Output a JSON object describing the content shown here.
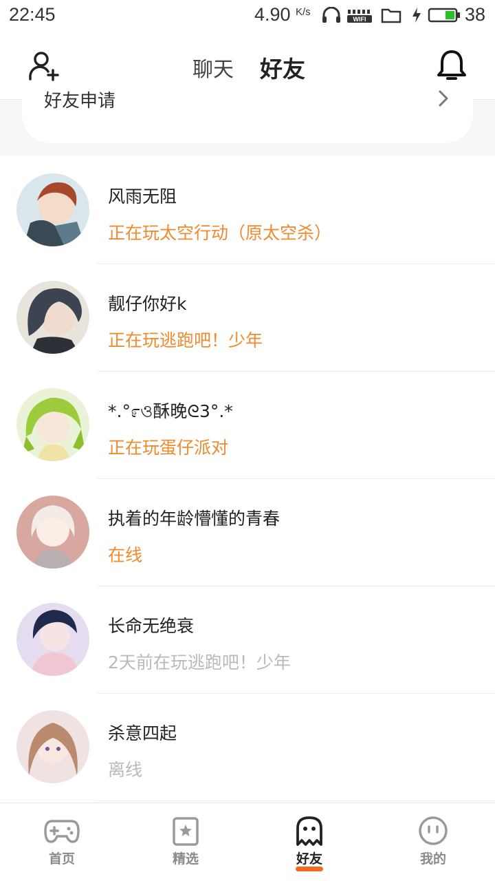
{
  "status_bar": {
    "time": "22:45",
    "net_speed": "4.90",
    "net_speed_unit": "K/s",
    "wifi_label": "WIFI",
    "battery_percent": "38"
  },
  "header": {
    "tabs": [
      {
        "label": "聊天",
        "active": false
      },
      {
        "label": "好友",
        "active": true
      }
    ],
    "accent_color": "#f26b1d"
  },
  "friend_request": {
    "label": "好友申请"
  },
  "friends": [
    {
      "name": "风雨无阻",
      "status": "正在玩太空行动（原太空杀）",
      "online": true
    },
    {
      "name": "靓仔你好k",
      "status": "正在玩逃跑吧！少年",
      "online": true
    },
    {
      "name": "*.°೯ও酥晚ᘓ3°.*",
      "status": "正在玩蛋仔派对",
      "online": true
    },
    {
      "name": "执着的年龄懵懂的青春",
      "status": "在线",
      "online": true
    },
    {
      "name": "长命无绝衰",
      "status": "2天前在玩逃跑吧！少年",
      "online": false
    },
    {
      "name": "杀意四起",
      "status": "离线",
      "online": false
    }
  ],
  "bottom_nav": {
    "items": [
      {
        "label": "首页",
        "icon": "gamepad-icon",
        "active": false
      },
      {
        "label": "精选",
        "icon": "star-bookmark-icon",
        "active": false
      },
      {
        "label": "好友",
        "icon": "ghost-icon",
        "active": true
      },
      {
        "label": "我的",
        "icon": "face-icon",
        "active": false
      }
    ]
  },
  "colors": {
    "online_status": "#f08a2c",
    "offline_status": "#b9b9b9"
  }
}
